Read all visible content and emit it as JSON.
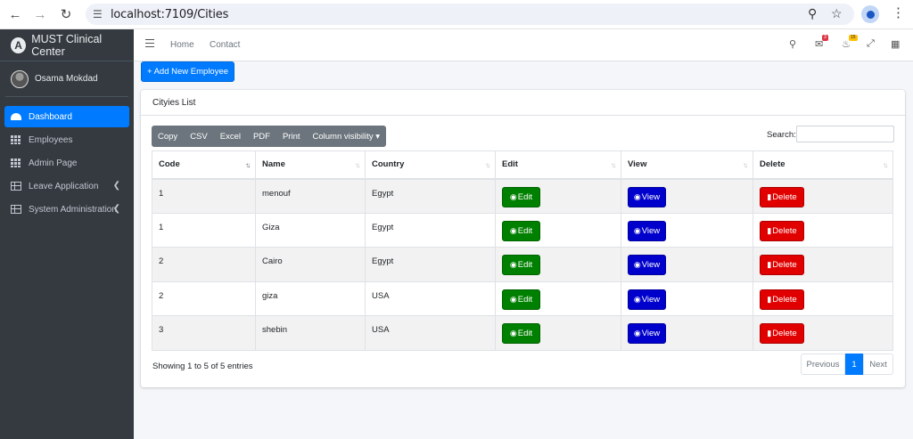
{
  "browser": {
    "url": "localhost:7109/Cities",
    "back_icon": "arrow-left-icon",
    "forward_icon": "arrow-right-icon",
    "reload_icon": "reload-icon"
  },
  "sidebar": {
    "brand": "MUST Clinical Center",
    "brand_logo": "A",
    "user_name": "Osama Mokdad",
    "items": [
      {
        "label": "Dashboard",
        "icon": "dashboard-icon",
        "active": true
      },
      {
        "label": "Employees",
        "icon": "grid-icon"
      },
      {
        "label": "Admin Page",
        "icon": "grid-icon"
      },
      {
        "label": "Leave Application",
        "icon": "table-icon",
        "has_children": true
      },
      {
        "label": "System Administration",
        "icon": "table-icon",
        "has_children": true
      }
    ]
  },
  "topnav": {
    "links": [
      "Home",
      "Contact"
    ],
    "messages_badge": "3",
    "notifications_badge": "15"
  },
  "content": {
    "add_button": "+ Add New Employee",
    "card_title": "Cityies List",
    "export_buttons": [
      "Copy",
      "CSV",
      "Excel",
      "PDF",
      "Print",
      "Column visibility ▾"
    ],
    "search_label": "Search:",
    "search_value": "",
    "columns": [
      "Code",
      "Name",
      "Country",
      "Edit",
      "View",
      "Delete"
    ],
    "rows": [
      {
        "code": "1",
        "name": "menouf",
        "country": "Egypt"
      },
      {
        "code": "1",
        "name": "Giza",
        "country": "Egypt"
      },
      {
        "code": "2",
        "name": "Cairo",
        "country": "Egypt"
      },
      {
        "code": "2",
        "name": "giza",
        "country": "USA"
      },
      {
        "code": "3",
        "name": "shebin",
        "country": "USA"
      }
    ],
    "edit_label": "Edit",
    "view_label": "View",
    "delete_label": "Delete",
    "info": "Showing 1 to 5 of 5 entries",
    "pager": {
      "prev": "Previous",
      "current": "1",
      "next": "Next"
    }
  },
  "colors": {
    "primary": "#007bff",
    "sidebar_bg": "#343a40",
    "edit": "#008000",
    "view": "#0000cc",
    "delete": "#e00000"
  }
}
